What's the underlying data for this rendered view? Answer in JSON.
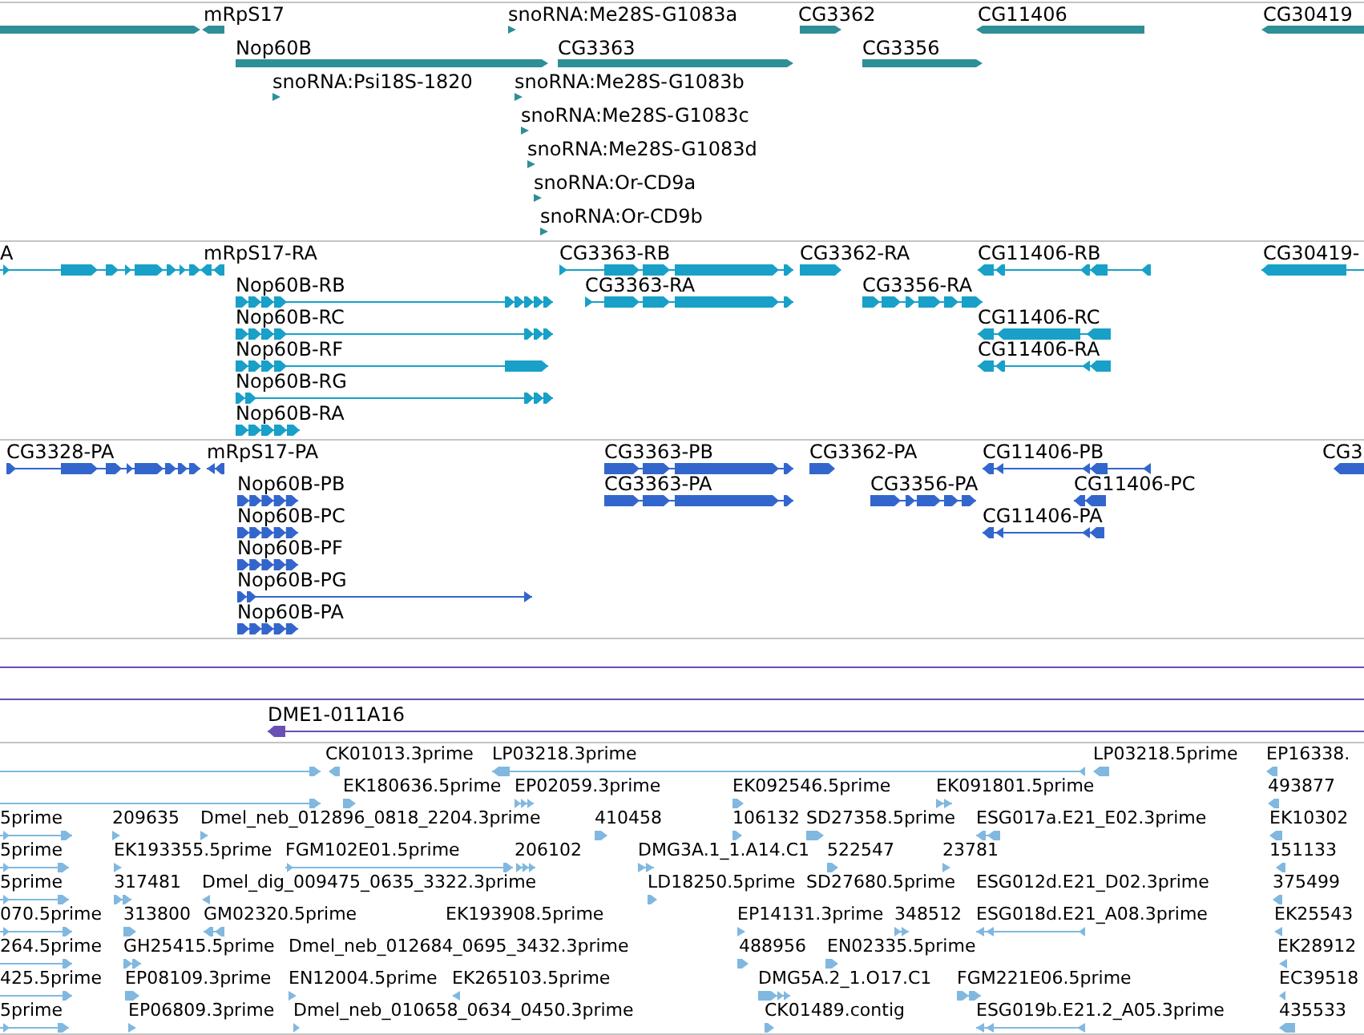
{
  "tracks": [
    {
      "kind": "gene",
      "color": "#2e8f96",
      "rows": [
        {
          "features": [
            {
              "reverse": false
            },
            {
              "label": "mRpS17",
              "reverse": true
            },
            {
              "label": "snoRNA:Me28S-G1083a",
              "reverse": false
            },
            {
              "label": "CG3362",
              "reverse": false
            },
            {
              "label": "CG11406",
              "reverse": true
            },
            {
              "label": "CG30419",
              "reverse": true
            }
          ]
        },
        {
          "features": [
            {
              "label": "Nop60B",
              "reverse": false
            },
            {
              "label": "CG3363",
              "reverse": false
            },
            {
              "label": "CG3356",
              "reverse": false
            }
          ]
        },
        {
          "features": [
            {
              "label": "snoRNA:Psi18S-1820",
              "reverse": false
            },
            {
              "label": "snoRNA:Me28S-G1083b",
              "reverse": false
            }
          ]
        },
        {
          "features": [
            {
              "label": "snoRNA:Me28S-G1083c",
              "reverse": false
            }
          ]
        },
        {
          "features": [
            {
              "label": "snoRNA:Me28S-G1083d",
              "reverse": false
            }
          ]
        },
        {
          "features": [
            {
              "label": "snoRNA:Or-CD9a",
              "reverse": false
            }
          ]
        },
        {
          "features": [
            {
              "label": "snoRNA:Or-CD9b",
              "reverse": false
            }
          ]
        }
      ]
    },
    {
      "kind": "transcript",
      "color": "#18a0c8",
      "rows": [
        {
          "features": [
            {
              "label": "A",
              "reverse": false
            },
            {
              "label": "mRpS17-RA",
              "reverse": true
            },
            {
              "label": "CG3363-RB",
              "reverse": false
            },
            {
              "label": "CG3362-RA",
              "reverse": false
            },
            {
              "label": "CG11406-RB",
              "reverse": true
            },
            {
              "label": "CG30419-",
              "reverse": true
            }
          ]
        },
        {
          "features": [
            {
              "label": "Nop60B-RB",
              "reverse": false
            },
            {
              "label": "CG3363-RA",
              "reverse": false
            },
            {
              "label": "CG3356-RA",
              "reverse": false
            }
          ]
        },
        {
          "features": [
            {
              "label": "Nop60B-RC",
              "reverse": false
            },
            {
              "label": "CG11406-RC",
              "reverse": true
            }
          ]
        },
        {
          "features": [
            {
              "label": "Nop60B-RF",
              "reverse": false
            },
            {
              "label": "CG11406-RA",
              "reverse": true
            }
          ]
        },
        {
          "features": [
            {
              "label": "Nop60B-RG",
              "reverse": false
            }
          ]
        },
        {
          "features": [
            {
              "label": "Nop60B-RA",
              "reverse": false
            }
          ]
        }
      ]
    },
    {
      "kind": "protein",
      "color": "#3366cc",
      "rows": [
        {
          "features": [
            {
              "label": "CG3328-PA",
              "reverse": false
            },
            {
              "label": "mRpS17-PA",
              "reverse": true
            },
            {
              "label": "CG3363-PB",
              "reverse": false
            },
            {
              "label": "CG3362-PA",
              "reverse": false
            },
            {
              "label": "CG11406-PB",
              "reverse": true
            },
            {
              "label": "CG3",
              "reverse": true
            }
          ]
        },
        {
          "features": [
            {
              "label": "Nop60B-PB",
              "reverse": false
            },
            {
              "label": "CG3363-PA",
              "reverse": false
            },
            {
              "label": "CG3356-PA",
              "reverse": false
            },
            {
              "label": "CG11406-PC",
              "reverse": true
            }
          ]
        },
        {
          "features": [
            {
              "label": "Nop60B-PC",
              "reverse": false
            },
            {
              "label": "CG11406-PA",
              "reverse": true
            }
          ]
        },
        {
          "features": [
            {
              "label": "Nop60B-PF",
              "reverse": false
            }
          ]
        },
        {
          "features": [
            {
              "label": "Nop60B-PG",
              "reverse": false
            }
          ]
        },
        {
          "features": [
            {
              "label": "Nop60B-PA",
              "reverse": false
            }
          ]
        }
      ]
    },
    {
      "kind": "clone",
      "color": "#6a4fb4",
      "rows": [
        {
          "features": [
            {
              "kind": "line"
            }
          ]
        },
        {
          "features": [
            {
              "kind": "line"
            }
          ]
        },
        {
          "features": [
            {
              "label": "DME1-011A16",
              "reverse": true
            }
          ]
        }
      ]
    },
    {
      "kind": "est",
      "color": "#80b8e0",
      "rows": [
        {
          "features": [
            {
              "reverse": false
            },
            {
              "label": "CK01013.3prime",
              "reverse": true
            },
            {
              "label": "LP03218.3prime",
              "reverse": true
            },
            {
              "label": "LP03218.5prime",
              "reverse": true
            },
            {
              "label": "EP16338.",
              "reverse": true
            }
          ]
        },
        {
          "features": [
            {
              "reverse": false
            },
            {
              "label": "EK180636.5prime",
              "reverse": false
            },
            {
              "label": "EP02059.3prime",
              "reverse": false
            },
            {
              "label": "EK092546.5prime",
              "reverse": false
            },
            {
              "label": "EK091801.5prime",
              "reverse": false
            },
            {
              "label": "493877",
              "reverse": true
            }
          ]
        },
        {
          "features": [
            {
              "label": "5prime",
              "reverse": false
            },
            {
              "label": "209635",
              "reverse": false
            },
            {
              "label": "Dmel_neb_012896_0818_2204.3prime",
              "reverse": false
            },
            {
              "label": "410458",
              "reverse": false
            },
            {
              "label": "106132",
              "reverse": false
            },
            {
              "label": "SD27358.5prime",
              "reverse": false
            },
            {
              "label": "ESG017a.E21_E02.3prime",
              "reverse": true
            },
            {
              "label": "EK10302",
              "reverse": true
            }
          ]
        },
        {
          "features": [
            {
              "label": "5prime",
              "reverse": false
            },
            {
              "label": "EK193355.5prime",
              "reverse": false
            },
            {
              "label": "FGM102E01.5prime",
              "reverse": false
            },
            {
              "label": "206102",
              "reverse": false
            },
            {
              "label": "DMG3A.1_1.A14.C1",
              "reverse": false
            },
            {
              "label": "522547",
              "reverse": false
            },
            {
              "label": "23781",
              "reverse": false
            },
            {
              "label": "151133",
              "reverse": true
            }
          ]
        },
        {
          "features": [
            {
              "label": "5prime",
              "reverse": false
            },
            {
              "label": "317481",
              "reverse": false
            },
            {
              "label": "Dmel_dig_009475_0635_3322.3prime",
              "reverse": true
            },
            {
              "label": "LD18250.5prime",
              "reverse": false
            },
            {
              "label": "SD27680.5prime"
            },
            {
              "label": "ESG012d.E21_D02.3prime"
            },
            {
              "label": "375499",
              "reverse": true
            }
          ]
        },
        {
          "features": [
            {
              "label": "070.5prime",
              "reverse": false
            },
            {
              "label": "313800",
              "reverse": false
            },
            {
              "label": "GM02320.5prime",
              "reverse": true
            },
            {
              "label": "EK193908.5prime"
            },
            {
              "label": "EP14131.3prime",
              "reverse": false
            },
            {
              "label": "348512",
              "reverse": false
            },
            {
              "label": "ESG018d.E21_A08.3prime",
              "reverse": true
            },
            {
              "label": "EK25543",
              "reverse": true
            }
          ]
        },
        {
          "features": [
            {
              "label": "264.5prime",
              "reverse": false
            },
            {
              "label": "GH25415.5prime",
              "reverse": false
            },
            {
              "label": "Dmel_neb_012684_0695_3432.3prime"
            },
            {
              "label": "488956",
              "reverse": false
            },
            {
              "label": "EN02335.5prime",
              "reverse": false
            },
            {
              "label": "EK28912",
              "reverse": true
            }
          ]
        },
        {
          "features": [
            {
              "label": "425.5prime",
              "reverse": false
            },
            {
              "label": "EP08109.3prime",
              "reverse": false
            },
            {
              "label": "EN12004.5prime",
              "reverse": false
            },
            {
              "label": "EK265103.5prime",
              "reverse": true
            },
            {
              "label": "DMG5A.2_1.O17.C1",
              "reverse": false
            },
            {
              "label": "FGM221E06.5prime",
              "reverse": false
            },
            {
              "label": "EC39518",
              "reverse": true
            }
          ]
        },
        {
          "features": [
            {
              "label": "5prime",
              "reverse": false
            },
            {
              "label": "EP06809.3prime",
              "reverse": false
            },
            {
              "label": "Dmel_neb_010658_0634_0450.3prime",
              "reverse": false
            },
            {
              "label": "CK01489.contig",
              "reverse": false
            },
            {
              "label": "ESG019b.E21.2_A05.3prime",
              "reverse": true
            },
            {
              "label": "435533",
              "reverse": true
            }
          ]
        }
      ]
    }
  ]
}
